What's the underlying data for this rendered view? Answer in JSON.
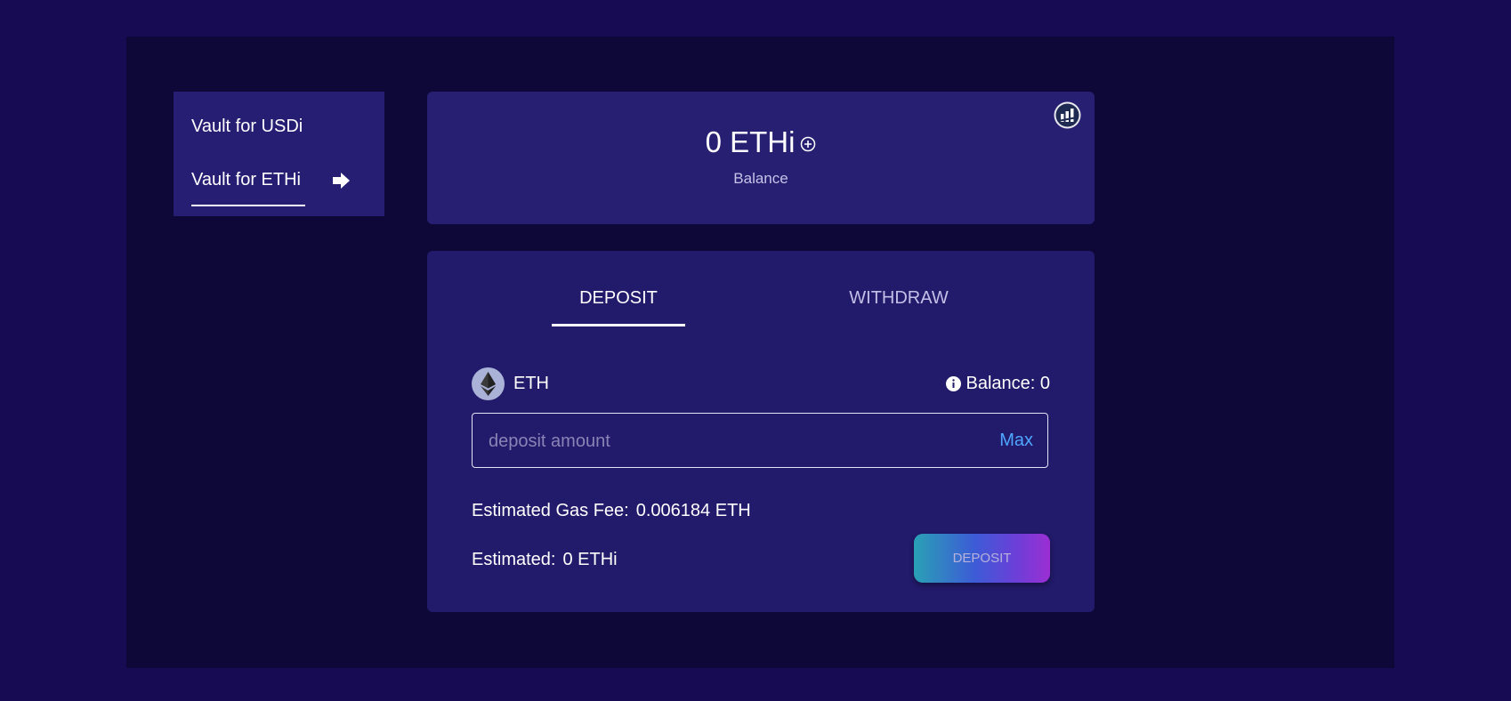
{
  "sidebar": {
    "items": [
      {
        "label": "Vault for USDi"
      },
      {
        "label": "Vault for ETHi"
      }
    ]
  },
  "balance_card": {
    "amount": "0 ETHi",
    "label": "Balance"
  },
  "deposit_card": {
    "tabs": [
      {
        "label": "DEPOSIT",
        "active": true
      },
      {
        "label": "WITHDRAW",
        "active": false
      }
    ],
    "token": "ETH",
    "balance_text": "Balance: 0",
    "amount_input": {
      "value": "",
      "placeholder": "deposit amount"
    },
    "max_label": "Max",
    "gas_fee_label": "Estimated Gas Fee:",
    "gas_fee_value": "0.006184 ETH",
    "estimated_label": "Estimated:",
    "estimated_value": "0 ETHi",
    "submit_label": "DEPOSIT"
  },
  "icons": [
    "arrow-right-icon",
    "add-circle-icon",
    "chart-icon",
    "eth-icon",
    "info-icon"
  ],
  "colors": {
    "page_bg": "#170c53",
    "frame_bg": "#0e0838",
    "card_bg": "#261f72",
    "accent_link": "#4fa6ff"
  }
}
